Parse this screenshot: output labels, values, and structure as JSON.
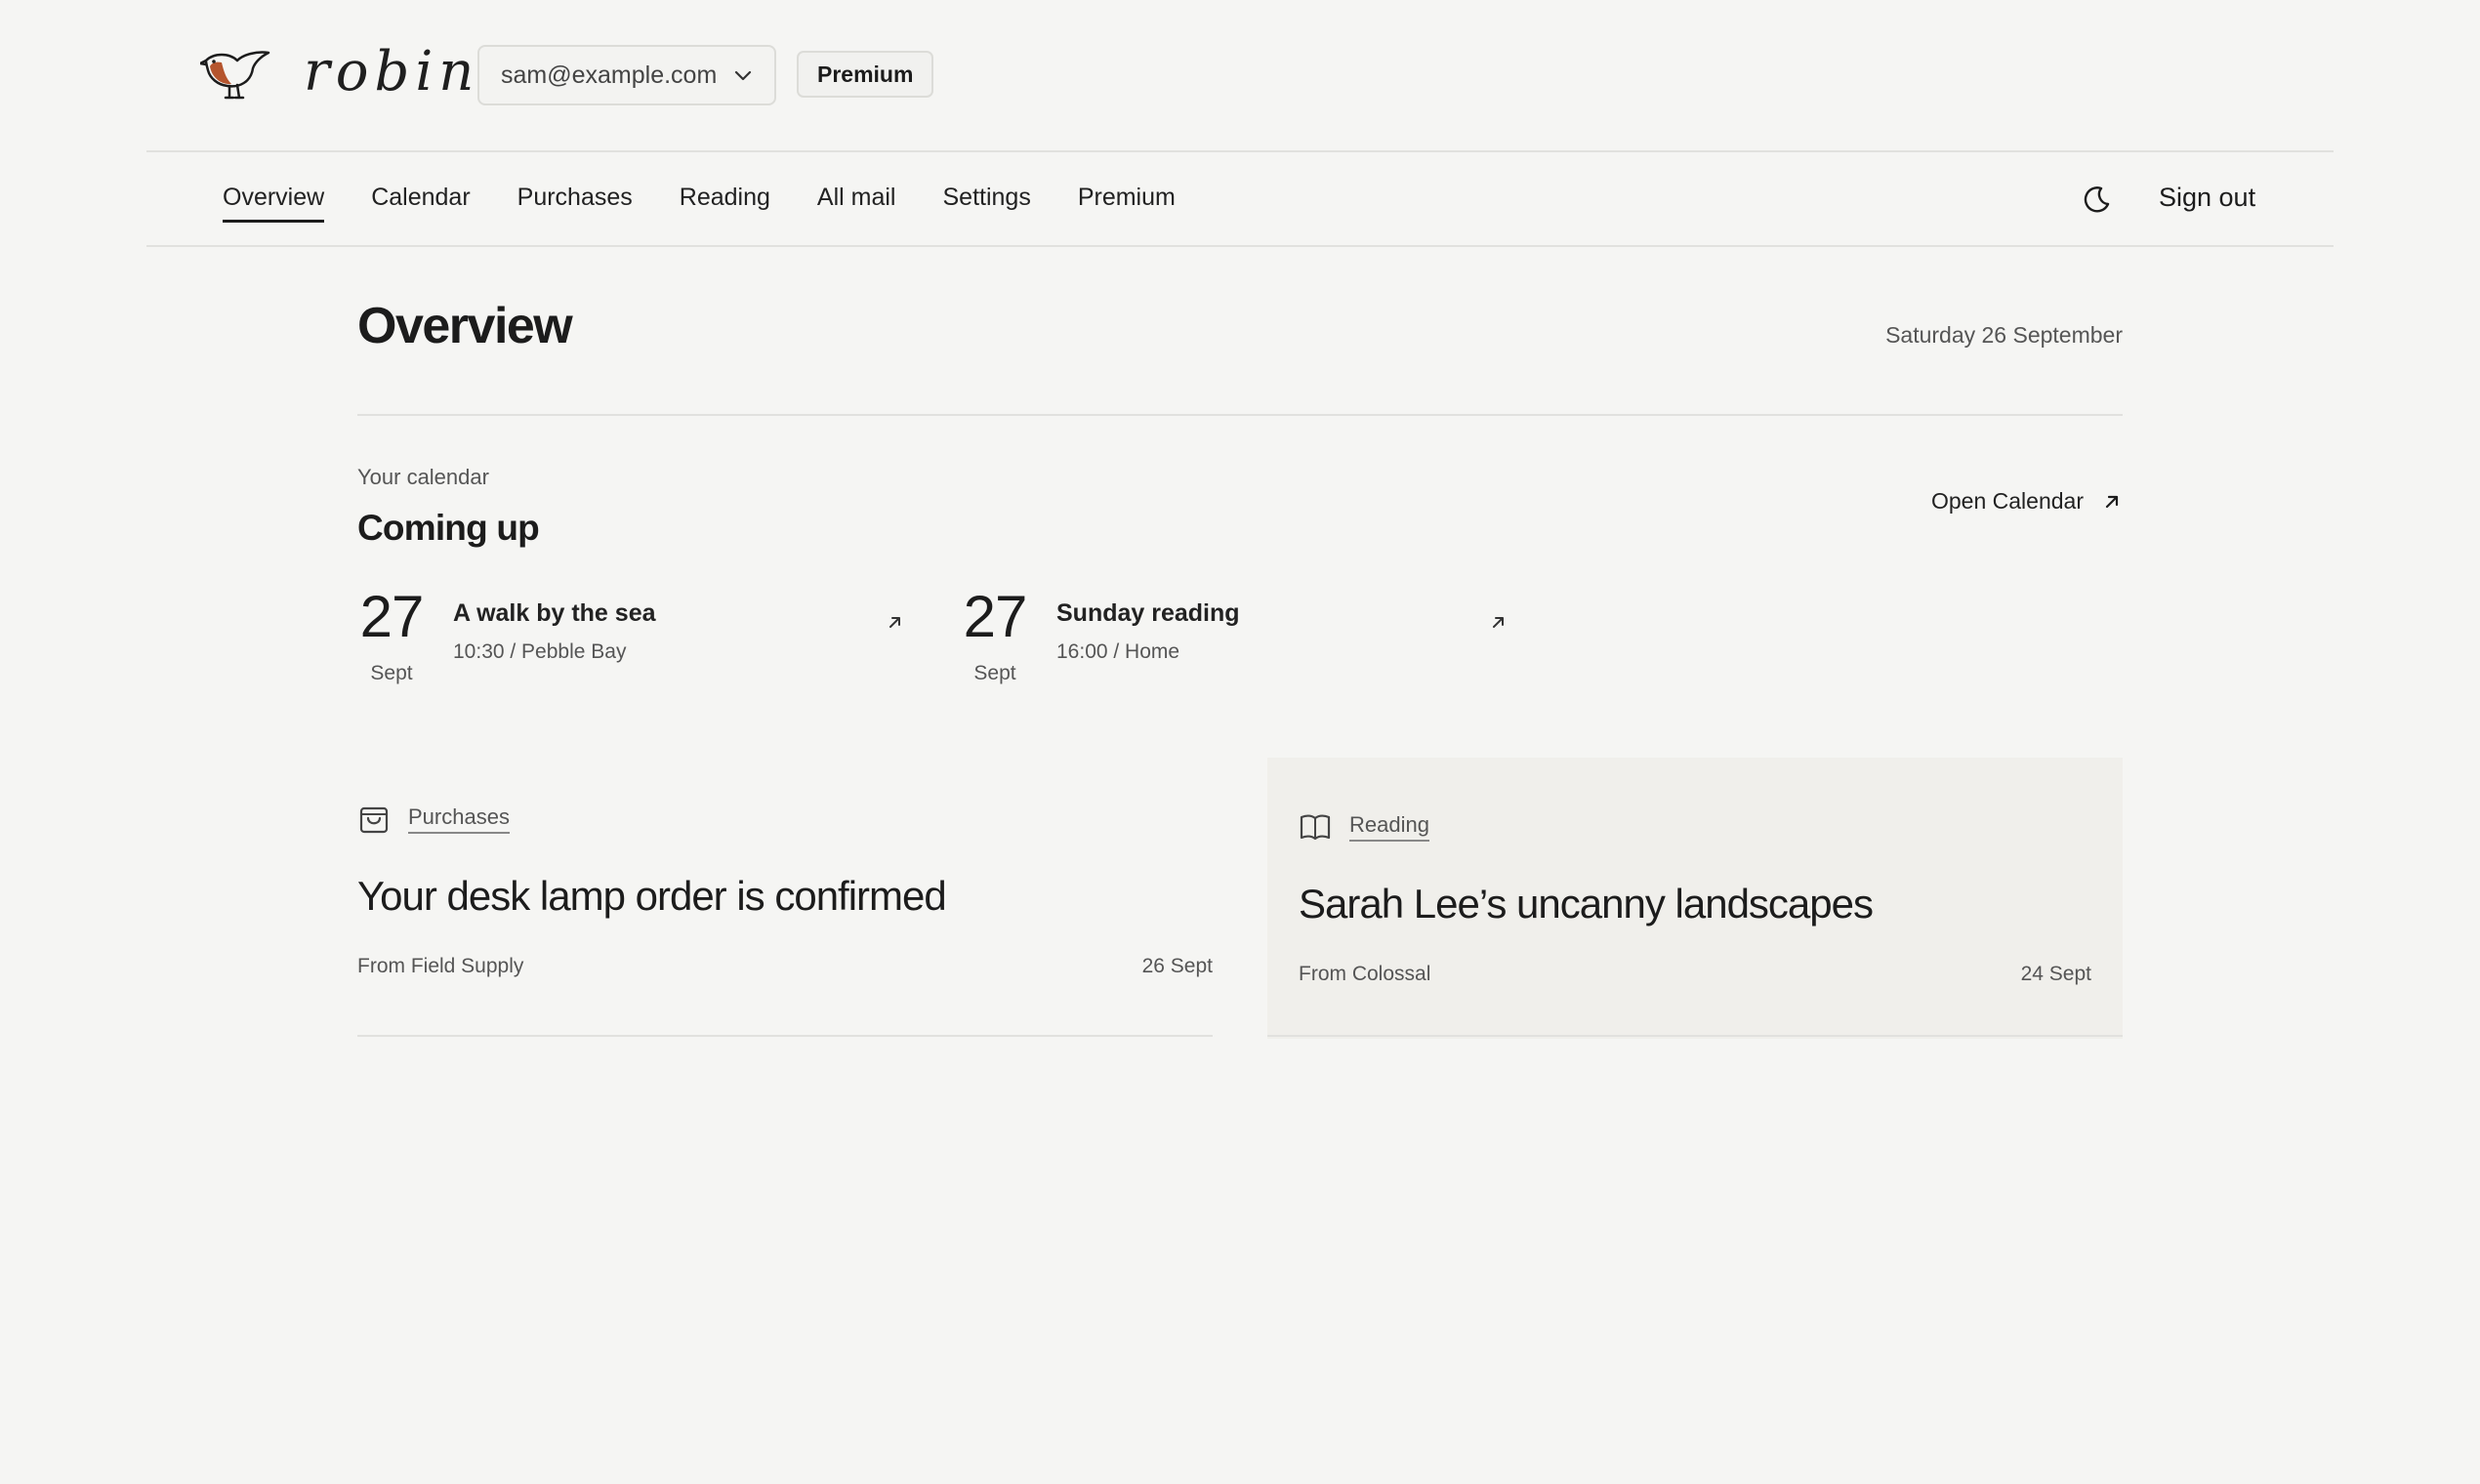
{
  "app": {
    "name": "robin",
    "account": "sam@example.com",
    "premium_badge": "Premium"
  },
  "nav": {
    "items": [
      "Overview",
      "Calendar",
      "Purchases",
      "Reading",
      "All mail",
      "Settings",
      "Premium"
    ],
    "active": "Overview",
    "sign_out": "Sign out"
  },
  "page": {
    "title": "Overview",
    "date": "Saturday 26 September"
  },
  "calendar": {
    "eyebrow": "Your calendar",
    "title": "Coming up",
    "open_label": "Open Calendar",
    "events": [
      {
        "day": "27",
        "month": "Sept",
        "title": "A walk by the sea",
        "meta": "10:30 / Pebble Bay"
      },
      {
        "day": "27",
        "month": "Sept",
        "title": "Sunday reading",
        "meta": "16:00 / Home"
      }
    ]
  },
  "cards": [
    {
      "category": "Purchases",
      "icon": "shopping-bag-icon",
      "title": "Your desk lamp order is confirmed",
      "from": "From Field Supply",
      "date": "26 Sept"
    },
    {
      "category": "Reading",
      "icon": "open-book-icon",
      "title": "Sarah Lee’s uncanny landscapes",
      "from": "From Colossal",
      "date": "24 Sept"
    }
  ],
  "colors": {
    "background": "#f5f5f3",
    "text": "#1c1c1c",
    "muted": "#555555",
    "card_shade": "#f0efeb",
    "robin_breast": "#b5552e"
  }
}
